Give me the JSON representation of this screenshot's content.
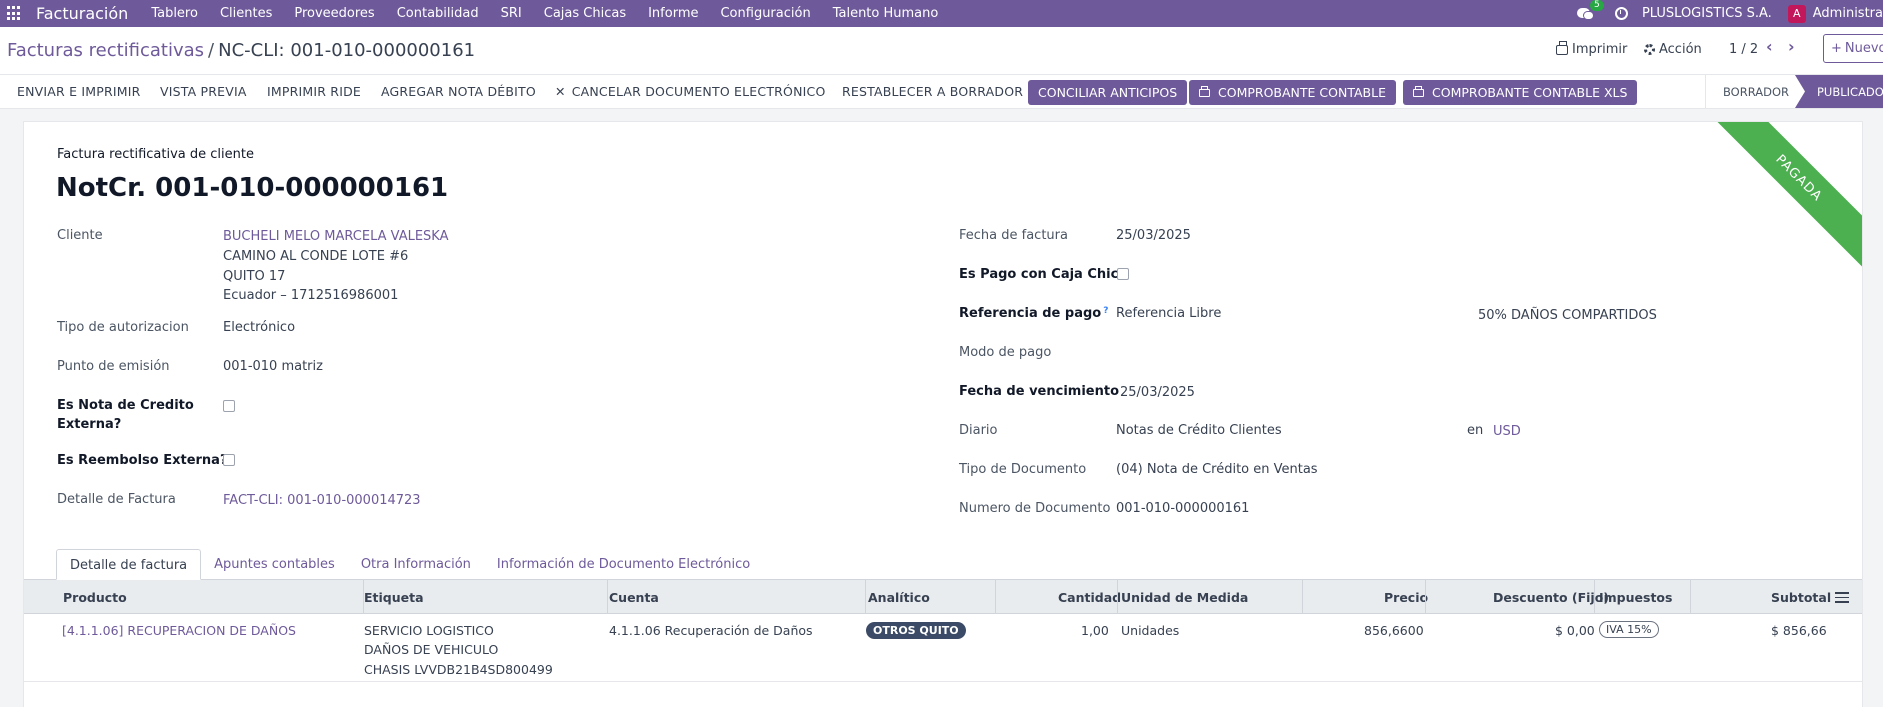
{
  "nav": {
    "brand": "Facturación",
    "menu": [
      "Tablero",
      "Clientes",
      "Proveedores",
      "Contabilidad",
      "SRI",
      "Cajas Chicas",
      "Informe",
      "Configuración",
      "Talento Humano"
    ],
    "chat_count": "5",
    "company": "PLUSLOGISTICS S.A.",
    "avatar_letter": "A",
    "user": "Administra"
  },
  "control": {
    "breadcrumb_parent": "Facturas rectificativas",
    "breadcrumb_sep": "/",
    "breadcrumb_current": "NC-CLI: 001-010-000000161",
    "print_label": "Imprimir",
    "action_label": "Acción",
    "pager": "1 / 2",
    "new_label": "Nuevo"
  },
  "statusbar": {
    "buttons": [
      "ENVIAR E IMPRIMIR",
      "VISTA PREVIA",
      "IMPRIMIR RIDE",
      "AGREGAR NOTA DÉBITO",
      "CANCELAR DOCUMENTO ELECTRÓNICO",
      "RESTABLECER A BORRADOR"
    ],
    "primary_buttons": [
      "CONCILIAR ANTICIPOS",
      "COMPROBANTE CONTABLE",
      "COMPROBANTE CONTABLE XLS"
    ],
    "states": [
      "BORRADOR",
      "PUBLICADO"
    ]
  },
  "form": {
    "ribbon": "PAGADA",
    "doc_type": "Factura rectificativa de cliente",
    "title": "NotCr. 001-010-000000161",
    "left": {
      "cliente_label": "Cliente",
      "cliente_name": "BUCHELI MELO MARCELA VALESKA",
      "cliente_addr1": "CAMINO AL CONDE LOTE #6",
      "cliente_addr2": "QUITO 17",
      "cliente_addr3": "Ecuador – 1712516986001",
      "tipo_aut_label": "Tipo de autorizacion",
      "tipo_aut_value": "Electrónico",
      "punto_label": "Punto de emisión",
      "punto_value": "001-010 matriz",
      "nota_ext_label_1": "Es Nota de Credito",
      "nota_ext_label_2": "Externa?",
      "reembolso_label": "Es Reembolso Externa?",
      "detalle_label": "Detalle de Factura",
      "detalle_value": "FACT-CLI: 001-010-000014723"
    },
    "right": {
      "fecha_label": "Fecha de factura",
      "fecha_value": "25/03/2025",
      "caja_label": "Es Pago con Caja Chica",
      "ref_label": "Referencia de pago",
      "ref_help": "?",
      "ref_value": "Referencia Libre",
      "ref_extra": "50% DAÑOS COMPARTIDOS",
      "modo_label": "Modo de pago",
      "venc_label": "Fecha de vencimiento",
      "venc_value": "25/03/2025",
      "diario_label": "Diario",
      "diario_value": "Notas de Crédito Clientes",
      "diario_en": "en",
      "currency": "USD",
      "tipo_doc_label": "Tipo de Documento",
      "tipo_doc_value": "(04) Nota de Crédito en Ventas",
      "num_doc_label": "Numero de Documento",
      "num_doc_value": "001-010-000000161"
    }
  },
  "tabs": [
    "Detalle de factura",
    "Apuntes contables",
    "Otra Información",
    "Información de Documento Electrónico"
  ],
  "table": {
    "headers": [
      "Producto",
      "Etiqueta",
      "Cuenta",
      "Analítico",
      "Cantidad",
      "Unidad de Medida",
      "Precio",
      "Descuento (Fijo)",
      "Impuestos",
      "Subtotal"
    ],
    "row": {
      "producto": "[4.1.1.06] RECUPERACION DE DAÑOS",
      "etiqueta_1": "SERVICIO LOGISTICO",
      "etiqueta_2": "DAÑOS DE VEHICULO",
      "etiqueta_3": "CHASIS LVVDB21B4SD800499",
      "cuenta": "4.1.1.06 Recuperación de Daños",
      "analitico": "OTROS QUITO",
      "cantidad": "1,00",
      "unidad": "Unidades",
      "precio": "856,6600",
      "descuento": "$ 0,00",
      "impuestos": "IVA 15%",
      "subtotal": "$ 856,66"
    }
  }
}
